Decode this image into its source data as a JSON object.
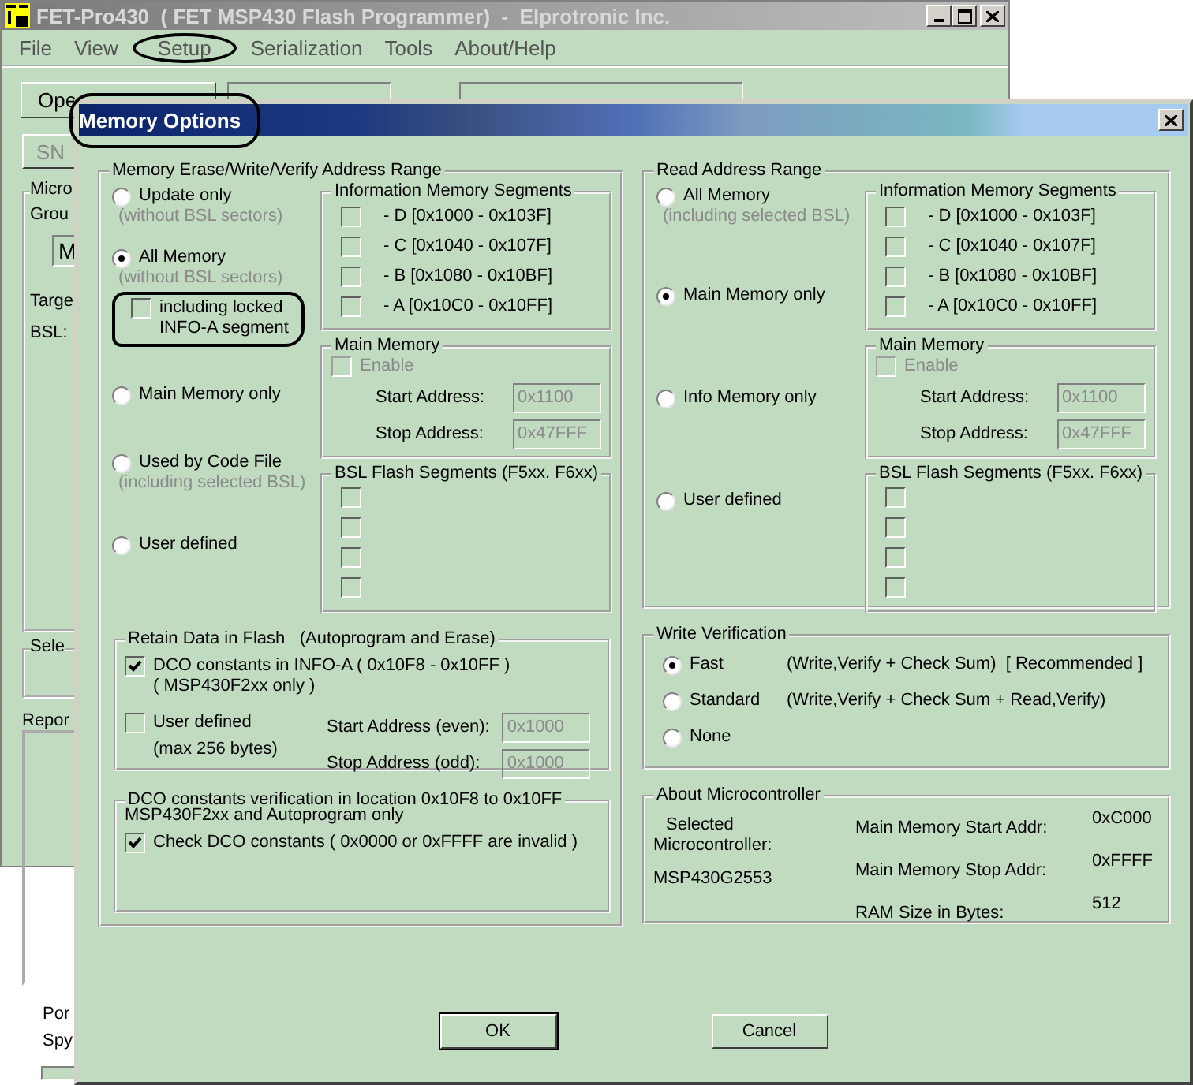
{
  "main_window": {
    "title": "FET-Pro430  ( FET MSP430 Flash Programmer)  -  Elprotronic Inc.",
    "menu": [
      {
        "label": "File"
      },
      {
        "label": "View"
      },
      {
        "label": "Setup"
      },
      {
        "label": "Serialization"
      },
      {
        "label": "Tools"
      },
      {
        "label": "About/Help"
      }
    ],
    "open_button": "Ope",
    "sn_button": "SN",
    "micro_group": "Micro",
    "group_label": "Grou",
    "group_combo": "M",
    "target_label": "Targe",
    "bsl_label": "BSL:",
    "select_group": "Sele",
    "report_label": "Repor",
    "port_label": "Por",
    "spy_label": "Spy"
  },
  "dialog": {
    "title": "Memory Options",
    "erase_range": {
      "title": "Memory Erase/Write/Verify Address Range",
      "options": [
        {
          "label": "Update only",
          "note": "(without BSL sectors)",
          "selected": false
        },
        {
          "label": "All Memory",
          "note": "(without BSL sectors)",
          "selected": true
        },
        {
          "label": "Main Memory only",
          "selected": false
        },
        {
          "label": "Used by Code File",
          "note": "(including selected BSL)",
          "selected": false
        },
        {
          "label": "User defined",
          "selected": false
        }
      ],
      "locked_info_a": {
        "label": "including locked INFO-A segment",
        "checked": false
      },
      "info_segments": {
        "title": "Information Memory Segments",
        "items": [
          {
            "name": "- D",
            "range": "[0x1000 - 0x103F]",
            "checked": false
          },
          {
            "name": "- C",
            "range": "[0x1040 - 0x107F]",
            "checked": false
          },
          {
            "name": "- B",
            "range": "[0x1080 - 0x10BF]",
            "checked": false
          },
          {
            "name": "- A",
            "range": "[0x10C0 - 0x10FF]",
            "checked": false
          }
        ]
      },
      "main_memory": {
        "title": "Main Memory",
        "disabled": true,
        "enable": {
          "label": "Enable",
          "checked": false
        },
        "start_label": "Start Address:",
        "start_value": "0x1100",
        "stop_label": "Stop Address:",
        "stop_value": "0x47FFF"
      },
      "bsl_segments": {
        "title": "BSL Flash Segments (F5xx. F6xx)",
        "items": [
          {
            "checked": false
          },
          {
            "checked": false
          },
          {
            "checked": false
          },
          {
            "checked": false
          }
        ]
      },
      "retain": {
        "title": "Retain Data in Flash   (Autoprogram and Erase)",
        "dco": {
          "label": "DCO constants in INFO-A ( 0x10F8 - 0x10FF )",
          "note": "( MSP430F2xx only )",
          "checked": true
        },
        "user": {
          "label": "User defined",
          "note": "(max 256 bytes)",
          "checked": false
        },
        "fields_disabled": true,
        "start_label": "Start Address (even):",
        "start_value": "0x1000",
        "stop_label": "Stop Address (odd):",
        "stop_value": "0x1000"
      },
      "dco_verify": {
        "title": "DCO constants verification in location 0x10F8 to 0x10FF",
        "subtitle": "MSP430F2xx and Autoprogram only",
        "check": {
          "label": "Check DCO constants ( 0x0000 or 0xFFFF are invalid )",
          "checked": true
        }
      }
    },
    "read_range": {
      "title": "Read Address Range",
      "options": [
        {
          "label": "All Memory",
          "note": "(including selected BSL)",
          "selected": false
        },
        {
          "label": "Main Memory only",
          "selected": true
        },
        {
          "label": "Info Memory only",
          "selected": false
        },
        {
          "label": "User defined",
          "selected": false
        }
      ],
      "info_segments": {
        "title": "Information Memory Segments",
        "items": [
          {
            "name": "- D",
            "range": "[0x1000 - 0x103F]",
            "checked": false
          },
          {
            "name": "- C",
            "range": "[0x1040 - 0x107F]",
            "checked": false
          },
          {
            "name": "- B",
            "range": "[0x1080 - 0x10BF]",
            "checked": false
          },
          {
            "name": "- A",
            "range": "[0x10C0 - 0x10FF]",
            "checked": false
          }
        ]
      },
      "main_memory": {
        "title": "Main Memory",
        "disabled": true,
        "enable": {
          "label": "Enable",
          "checked": false
        },
        "start_label": "Start Address:",
        "start_value": "0x1100",
        "stop_label": "Stop Address:",
        "stop_value": "0x47FFF"
      },
      "bsl_segments": {
        "title": "BSL Flash Segments (F5xx. F6xx)",
        "items": [
          {
            "checked": false
          },
          {
            "checked": false
          },
          {
            "checked": false
          },
          {
            "checked": false
          }
        ]
      }
    },
    "write_verification": {
      "title": "Write Verification",
      "options": [
        {
          "label": "Fast",
          "detail": "(Write,Verify + Check Sum)  [ Recommended ]",
          "selected": true
        },
        {
          "label": "Standard",
          "detail": "(Write,Verify + Check Sum + Read,Verify)",
          "selected": false
        },
        {
          "label": "None",
          "selected": false
        }
      ]
    },
    "about": {
      "title": "About Microcontroller",
      "selected_label": "Selected",
      "selected_label_2": "Microcontroller:",
      "device": "MSP430G2553",
      "rows": [
        {
          "label": "Main Memory Start Addr:",
          "value": "0xC000"
        },
        {
          "label": "Main Memory Stop Addr:",
          "value": "0xFFFF"
        },
        {
          "label": "RAM Size in Bytes:",
          "value": "512"
        }
      ]
    },
    "buttons": [
      {
        "label": "OK",
        "default": true
      },
      {
        "label": "Cancel",
        "default": false
      }
    ]
  }
}
